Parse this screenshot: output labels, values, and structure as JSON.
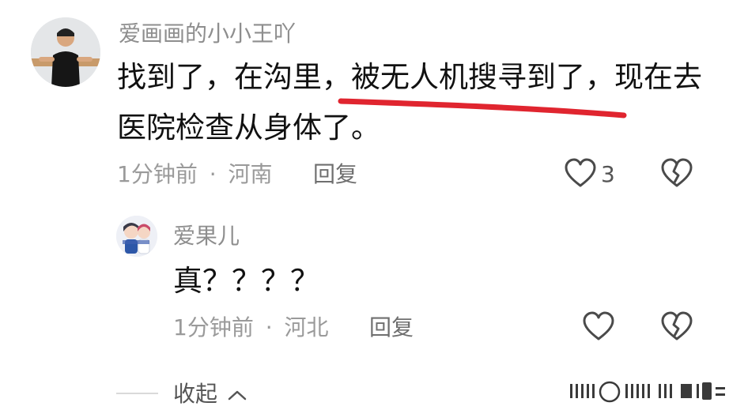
{
  "comment": {
    "username": "爱画画的小小王吖",
    "text_line1_before": "找到了，在沟里，",
    "text_line1_highlight": "被无人机搜寻到了",
    "text_line1_after": "，现在去",
    "text_line2": "医院检查从身体了。",
    "time": "1分钟前",
    "separator": "·",
    "location": "河南",
    "reply_label": "回复",
    "like_count": "3",
    "highlight_color": "#e0252f"
  },
  "reply": {
    "username": "爱果儿",
    "text": "真？？？？",
    "time": "1分钟前",
    "separator": "·",
    "location": "河北",
    "reply_label": "回复"
  },
  "collapse": {
    "label": "收起",
    "icon": "chevron-up-icon"
  },
  "icons": {
    "like": "heart-outline-icon",
    "dislike": "broken-heart-icon"
  }
}
